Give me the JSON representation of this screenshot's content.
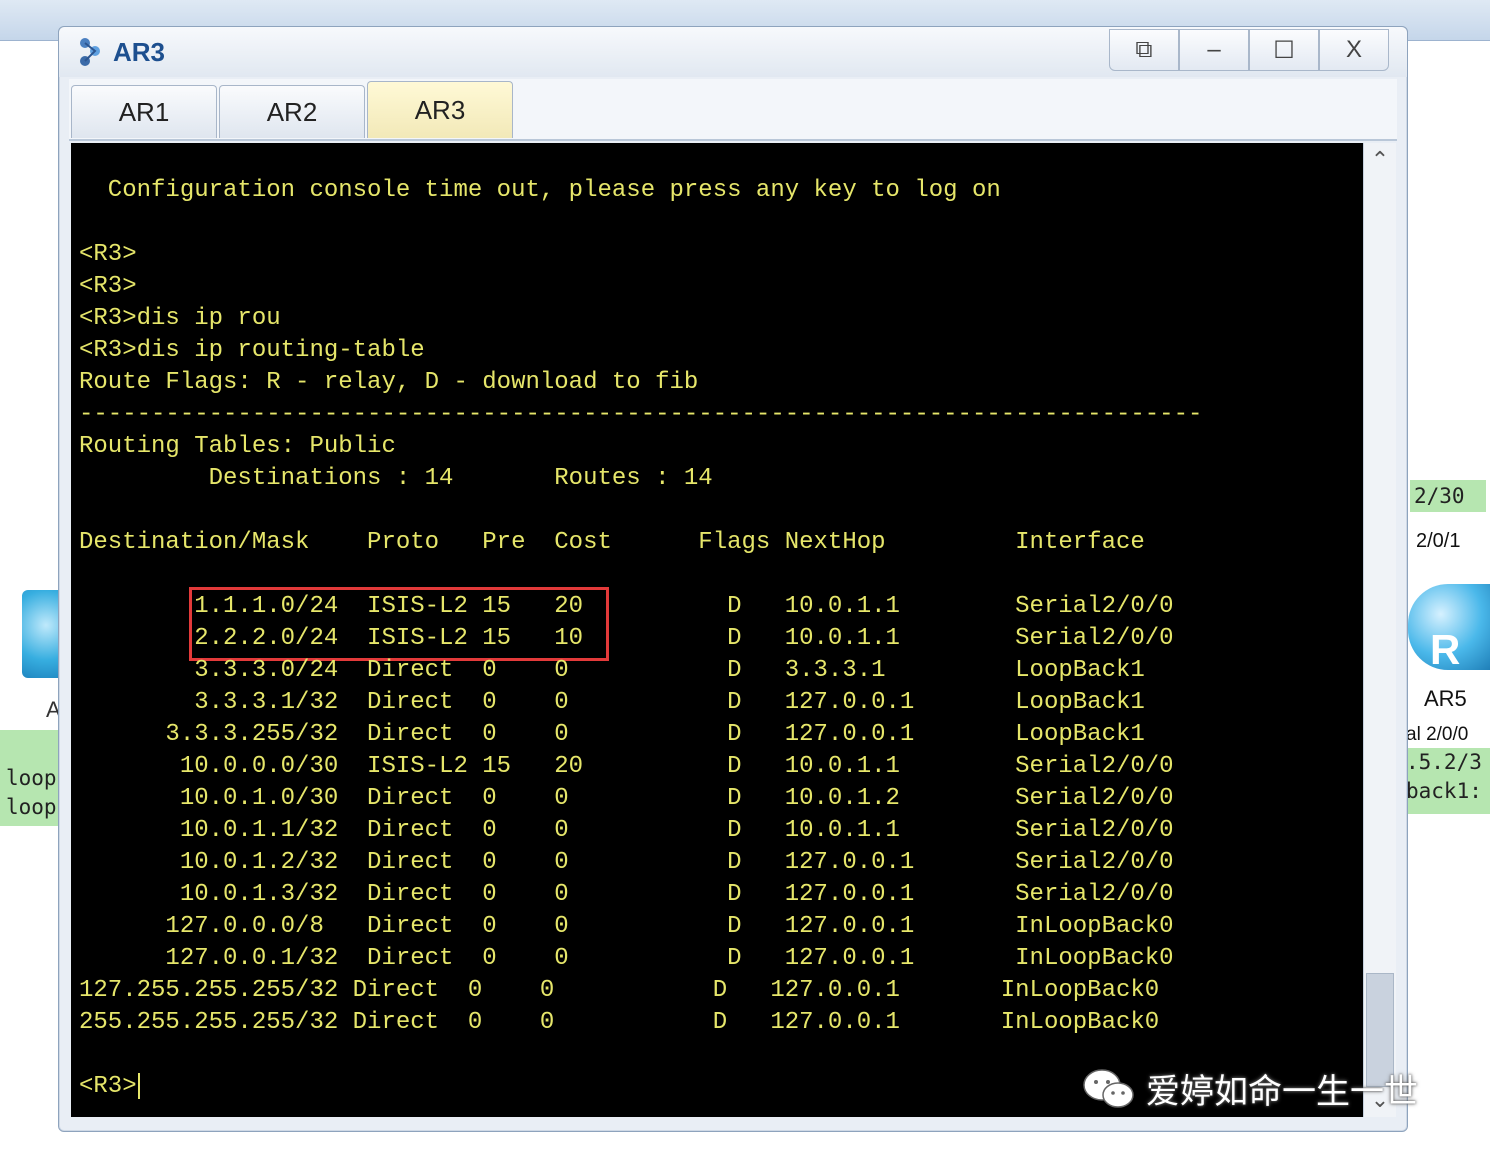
{
  "background": {
    "left_letter": "A",
    "left_labels": [
      "loop",
      "loop"
    ],
    "right_top_label": "2/30",
    "right_port": "2/0/1",
    "right_router_letter": "R",
    "right_router_name": "AR5",
    "right_iface": "al 2/0/0",
    "right_labels": [
      ".5.2/3",
      "back1:"
    ]
  },
  "window": {
    "title": "AR3",
    "controls": {
      "restore": "⧉",
      "minimize": "–",
      "maximize": "☐",
      "close": "X"
    }
  },
  "tabs": [
    {
      "label": "AR1",
      "active": false
    },
    {
      "label": "AR2",
      "active": false
    },
    {
      "label": "AR3",
      "active": true
    }
  ],
  "terminal": {
    "lines": [
      "  Configuration console time out, please press any key to log on",
      "",
      "<R3>",
      "<R3>",
      "<R3>dis ip rou",
      "<R3>dis ip routing-table",
      "Route Flags: R - relay, D - download to fib",
      "------------------------------------------------------------------------------",
      "Routing Tables: Public",
      "         Destinations : 14       Routes : 14",
      "",
      "Destination/Mask    Proto   Pre  Cost      Flags NextHop         Interface",
      "",
      "        1.1.1.0/24  ISIS-L2 15   20          D   10.0.1.1        Serial2/0/0",
      "        2.2.2.0/24  ISIS-L2 15   10          D   10.0.1.1        Serial2/0/0",
      "        3.3.3.0/24  Direct  0    0           D   3.3.3.1         LoopBack1",
      "        3.3.3.1/32  Direct  0    0           D   127.0.0.1       LoopBack1",
      "      3.3.3.255/32  Direct  0    0           D   127.0.0.1       LoopBack1",
      "       10.0.0.0/30  ISIS-L2 15   20          D   10.0.1.1        Serial2/0/0",
      "       10.0.1.0/30  Direct  0    0           D   10.0.1.2        Serial2/0/0",
      "       10.0.1.1/32  Direct  0    0           D   10.0.1.1        Serial2/0/0",
      "       10.0.1.2/32  Direct  0    0           D   127.0.0.1       Serial2/0/0",
      "       10.0.1.3/32  Direct  0    0           D   127.0.0.1       Serial2/0/0",
      "      127.0.0.0/8   Direct  0    0           D   127.0.0.1       InLoopBack0",
      "      127.0.0.1/32  Direct  0    0           D   127.0.0.1       InLoopBack0",
      "127.255.255.255/32 Direct  0    0           D   127.0.0.1       InLoopBack0",
      "255.255.255.255/32 Direct  0    0           D   127.0.0.1       InLoopBack0",
      "",
      "<R3>"
    ]
  },
  "watermark": {
    "text": "爱婷如命一生一世"
  },
  "colors": {
    "terminal_text": "#e6e66a",
    "terminal_bg": "#000000",
    "highlight": "#e33a3a"
  }
}
